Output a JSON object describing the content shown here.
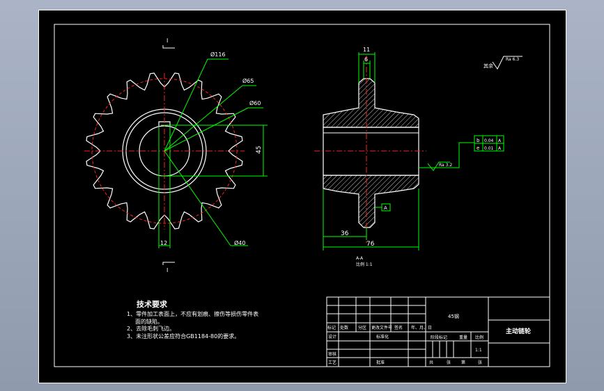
{
  "drawing": {
    "section_marker": "I",
    "dimensions": {
      "d_tip": "Ø116",
      "d_65": "Ø65",
      "d_60": "Ø60",
      "d_bore": "Ø40",
      "height_45": "45",
      "key_width": "12",
      "hub_11": "11",
      "tooth_6": "6",
      "len_36": "36",
      "len_76": "76"
    },
    "roughness_label": "Ra 6.3",
    "roughness_prefix": "其余",
    "roughness_callout": "Ra 3.2",
    "datum_label": "A",
    "tolerance_rows": [
      {
        "symbol": "b",
        "value": "0.04",
        "datum": "A"
      },
      {
        "symbol": "e",
        "value": "0.01",
        "datum": "A"
      }
    ],
    "section_caption": "A-A",
    "section_scale": "比例 1:1"
  },
  "tech": {
    "title": "技术要求",
    "line1": "1、零件加工表面上，不应有划痕、擦伤等损伤零件表",
    "line1b": "面的缺陷。",
    "line2": "2、去除毛刺飞边。",
    "line3": "3、未注形状公差应符合GB1184-80的要求。"
  },
  "titleblock": {
    "material": "45钢",
    "part_name": "主动链轮",
    "h_mark": "标记",
    "h_count": "处数",
    "h_zone": "分区",
    "h_doc": "更改文件号",
    "h_sign": "签名",
    "h_date": "年、月、日",
    "r_design": "设计",
    "r_std": "标准化",
    "r_review": "审核",
    "r_process": "工艺",
    "r_approve": "批准",
    "stage": "阶段标记",
    "weight": "重量",
    "scale": "比例",
    "scale_val": "1:1",
    "sheets": "共",
    "sheet_of": "张",
    "sheet_no": "第",
    "sheet_zhang": "张"
  }
}
